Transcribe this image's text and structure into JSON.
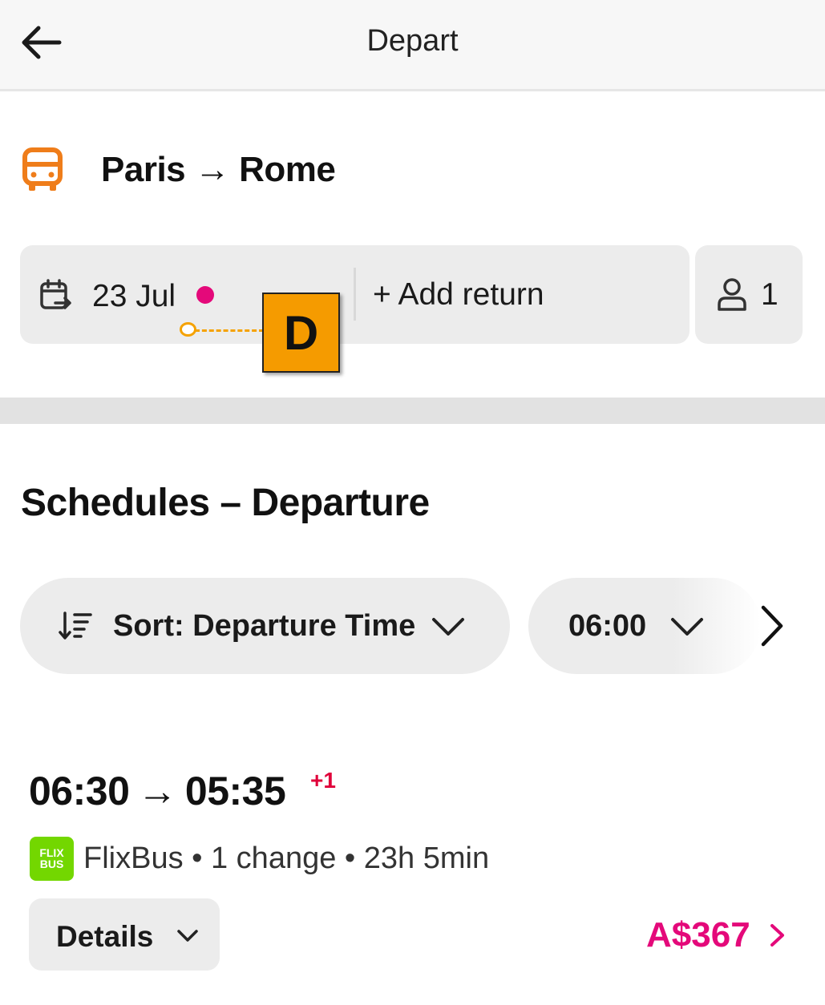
{
  "header": {
    "title": "Depart",
    "back_icon": "arrow-left-icon"
  },
  "route": {
    "icon": "bus-icon",
    "title": "Paris → Rome",
    "icon_color": "#ef7d1a"
  },
  "date_selector": {
    "icon": "calendar-icon",
    "date": "23 Jul",
    "add_return_label": "+ Add return",
    "indicator_color": "#e4097a"
  },
  "passengers": {
    "icon": "person-icon",
    "count": "1"
  },
  "annotation_marker": {
    "label": "D",
    "color": "#f59b00"
  },
  "schedules": {
    "title": "Schedules – Departure"
  },
  "filters": {
    "sort_label": "Sort: Departure Time",
    "sort_icon": "sort-icon",
    "time_label": "06:00",
    "scroll_icon": "chevron-right-icon"
  },
  "trip": {
    "depart_time": "06:30",
    "arrow": "→",
    "arrive_time": "05:35",
    "day_offset": "+1",
    "carrier_logo_line1": "FLIX",
    "carrier_logo_line2": "BUS",
    "carrier_info": "FlixBus • 1 change • 23h 5min",
    "details_label": "Details",
    "price": "A$367",
    "price_color": "#e4097a",
    "logo_color": "#73d700"
  }
}
